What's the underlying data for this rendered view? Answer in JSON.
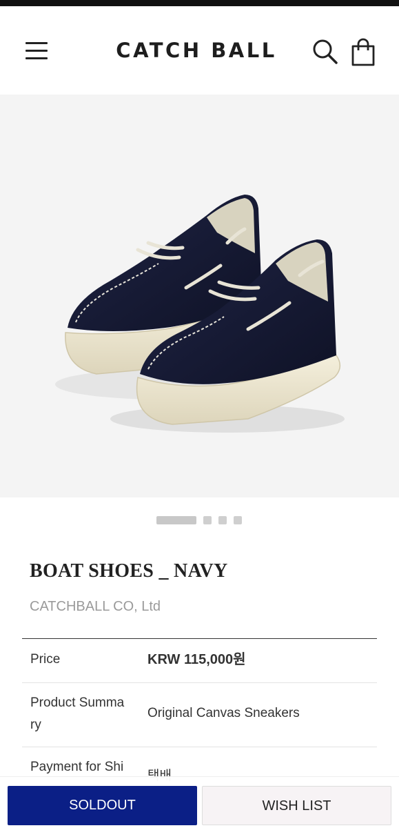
{
  "app": {
    "logo": "CATCH BALL"
  },
  "header": {
    "icons": {
      "menu": "hamburger-menu-icon",
      "search": "search-icon",
      "cart": "shopping-bag-icon"
    }
  },
  "gallery": {
    "total_images": 4,
    "current_index": 1,
    "image_subject": "navy canvas boat shoes pair"
  },
  "product": {
    "title": "BOAT SHOES _ NAVY",
    "brand": "CATCHBALL CO, Ltd",
    "info": [
      {
        "key": "Price",
        "value": "KRW 115,000원"
      },
      {
        "key": "Product Summa ry",
        "value": "Original Canvas Sneakers"
      },
      {
        "key": "Payment for Shi",
        "value": "택배"
      }
    ]
  },
  "actions": {
    "soldout_label": "SOLDOUT",
    "wishlist_label": "WISH LIST"
  },
  "colors": {
    "soldout_bg": "#0b1f86",
    "shoe_navy": "#161a33",
    "sole_cream": "#efe9d4"
  }
}
